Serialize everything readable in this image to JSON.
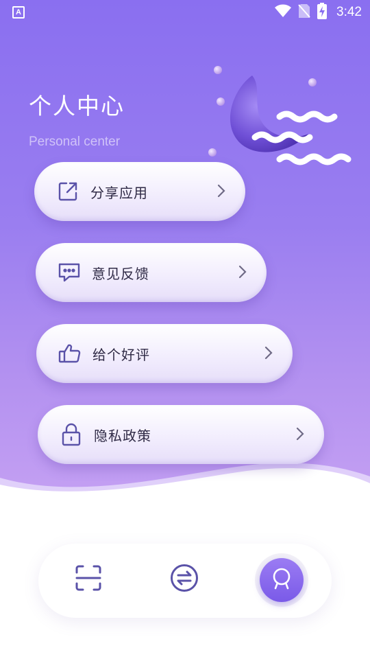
{
  "status_bar": {
    "app_icon_letter": "A",
    "time": "3:42",
    "icons": [
      "wifi-icon",
      "no-sim-icon",
      "battery-charging-icon"
    ]
  },
  "header": {
    "title": "个人中心",
    "subtitle": "Personal center"
  },
  "menu": {
    "items": [
      {
        "label": "分享应用",
        "icon": "share-icon"
      },
      {
        "label": "意见反馈",
        "icon": "feedback-icon"
      },
      {
        "label": "给个好评",
        "icon": "thumbs-up-icon"
      },
      {
        "label": "隐私政策",
        "icon": "lock-icon"
      }
    ]
  },
  "bottom_nav": {
    "items": [
      {
        "icon": "scan-icon",
        "active": false
      },
      {
        "icon": "convert-icon",
        "active": false
      },
      {
        "icon": "profile-badge-icon",
        "active": true
      }
    ]
  },
  "colors": {
    "accent": "#8a6ff0",
    "icon_color": "#5a52a8",
    "text_dark": "#2f2a45"
  }
}
